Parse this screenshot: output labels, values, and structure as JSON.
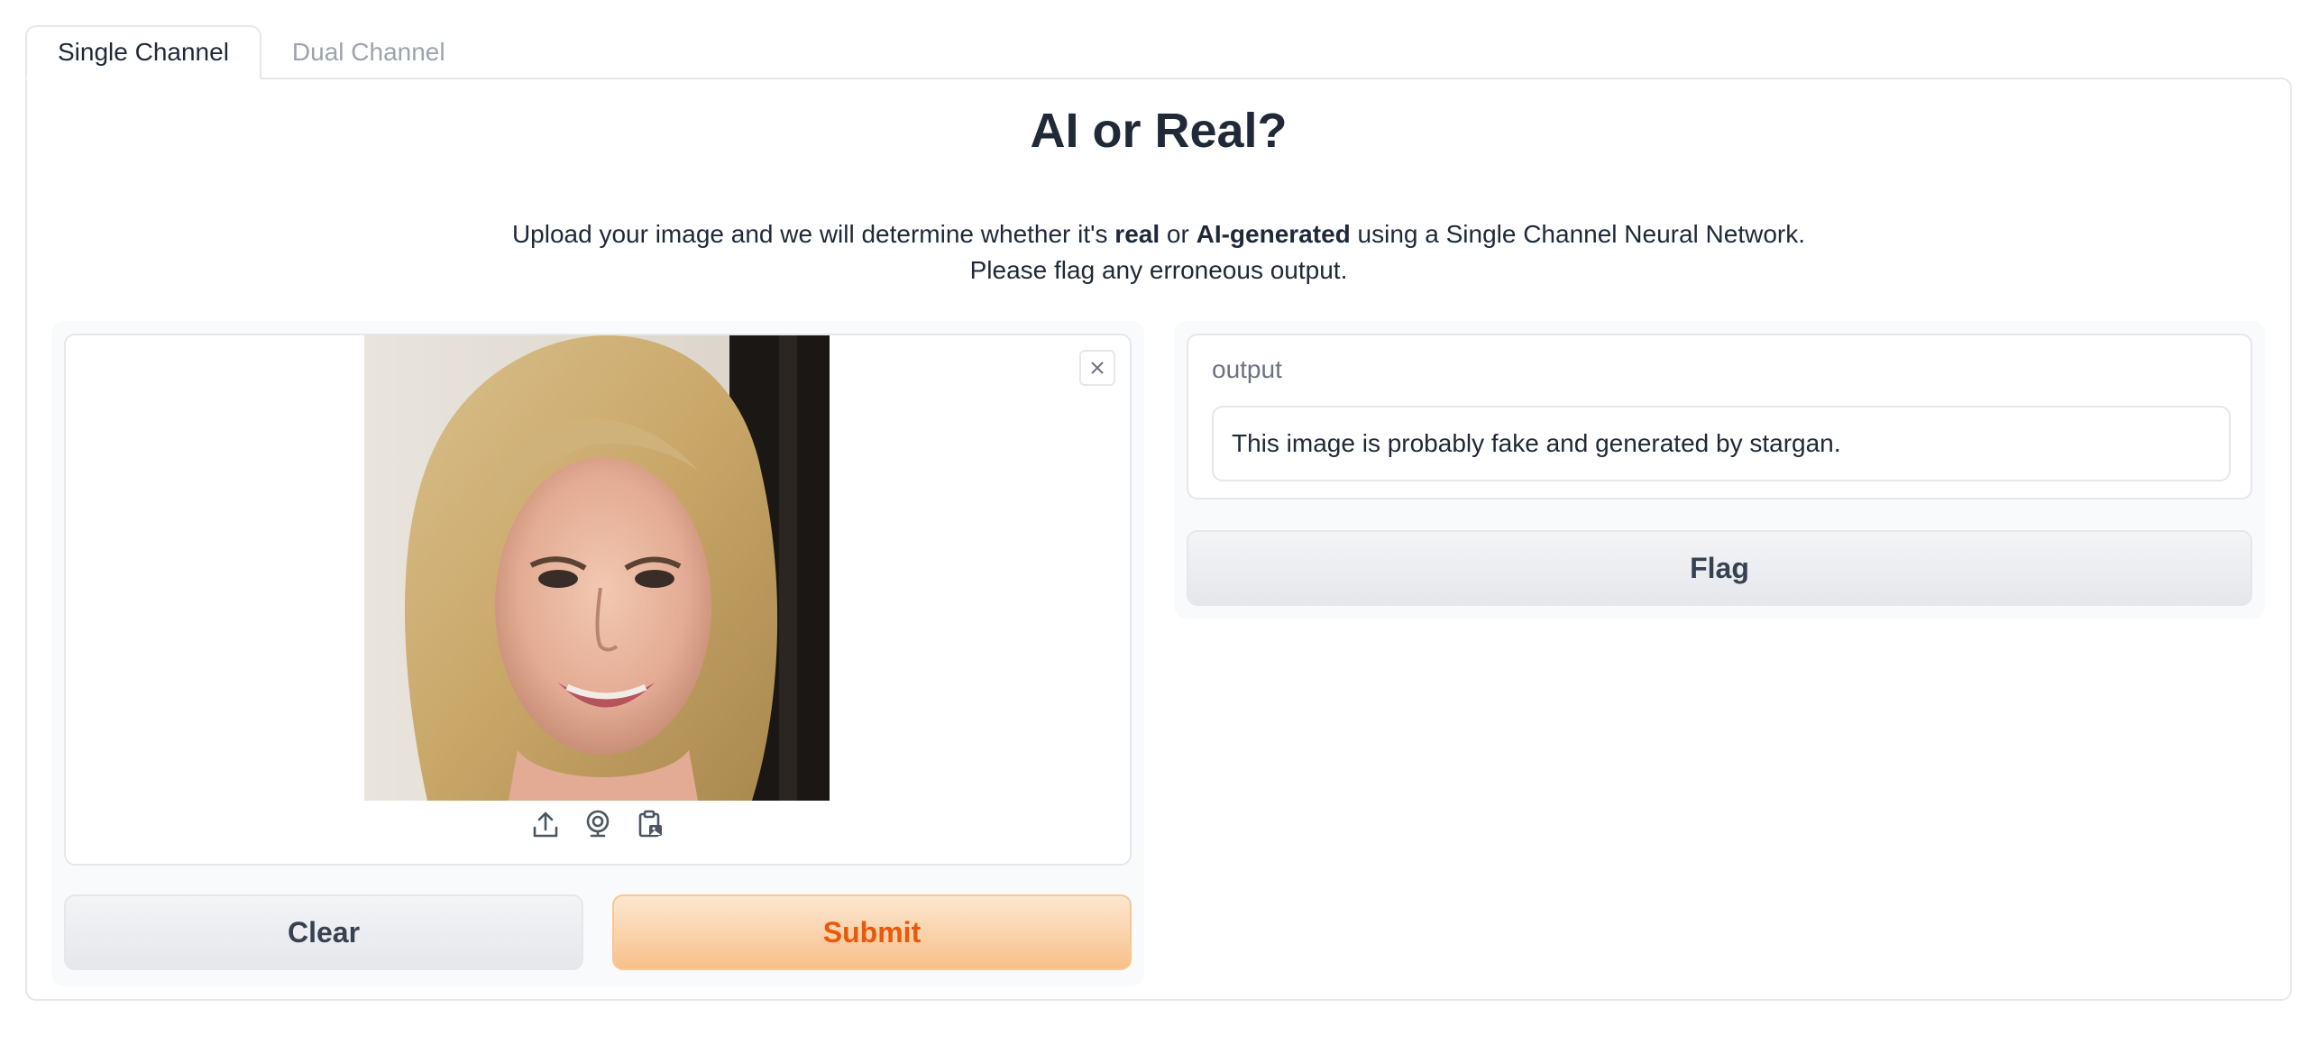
{
  "tabs": [
    {
      "label": "Single Channel",
      "active": true
    },
    {
      "label": "Dual Channel",
      "active": false
    }
  ],
  "title": "AI or Real?",
  "description": {
    "line1_before": "Upload your image and we will determine whether it's ",
    "line1_bold1": "real",
    "line1_mid": " or ",
    "line1_bold2": "AI-generated",
    "line1_after": " using a Single Channel Neural Network.",
    "line2": "Please flag any erroneous output."
  },
  "input": {
    "icons": [
      "upload-icon",
      "webcam-icon",
      "clipboard-icon",
      "close-icon"
    ]
  },
  "buttons": {
    "clear": "Clear",
    "submit": "Submit",
    "flag": "Flag"
  },
  "output": {
    "label": "output",
    "value": "This image is probably fake and generated by stargan."
  },
  "colors": {
    "primary_text": "#ea580c",
    "primary_bg": "#f7c08a",
    "border": "#e5e7eb",
    "block_bg": "#f9fafb"
  }
}
